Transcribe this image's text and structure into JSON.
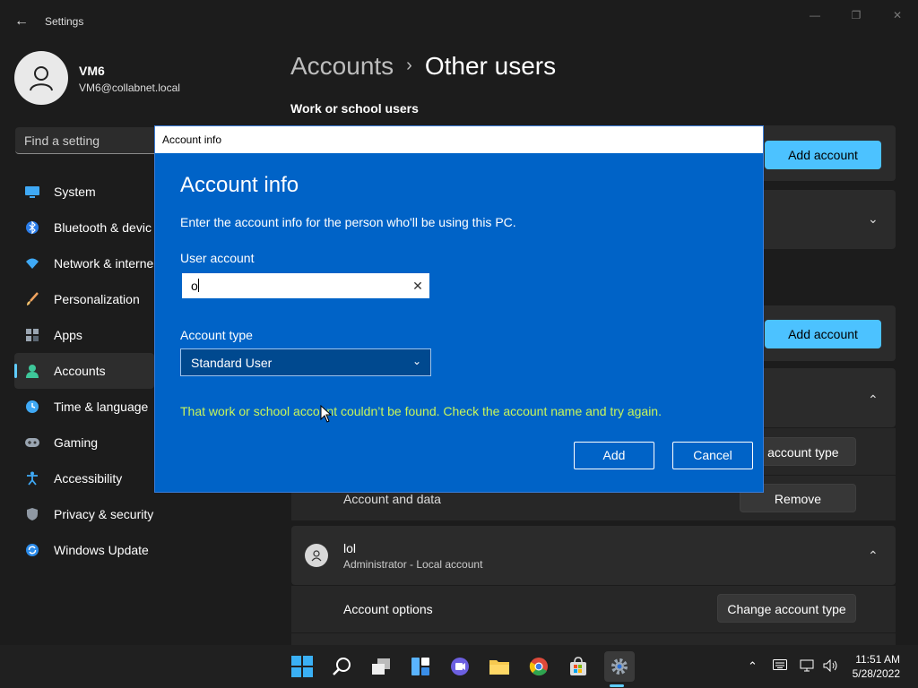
{
  "window": {
    "title": "Settings",
    "back_icon": "←",
    "minimize_icon": "—",
    "maximize_icon": "❐",
    "close_icon": "✕"
  },
  "profile": {
    "name": "VM6",
    "email": "VM6@collabnet.local"
  },
  "search": {
    "placeholder": "Find a setting"
  },
  "sidebar": {
    "items": [
      {
        "label": "System",
        "icon": "system-icon"
      },
      {
        "label": "Bluetooth & devic",
        "icon": "bluetooth-icon"
      },
      {
        "label": "Network & interne",
        "icon": "network-icon"
      },
      {
        "label": "Personalization",
        "icon": "brush-icon"
      },
      {
        "label": "Apps",
        "icon": "apps-icon"
      },
      {
        "label": "Accounts",
        "icon": "accounts-icon",
        "active": true
      },
      {
        "label": "Time & language",
        "icon": "clock-icon"
      },
      {
        "label": "Gaming",
        "icon": "gamepad-icon"
      },
      {
        "label": "Accessibility",
        "icon": "accessibility-icon"
      },
      {
        "label": "Privacy & security",
        "icon": "shield-icon"
      },
      {
        "label": "Windows Update",
        "icon": "update-icon"
      }
    ]
  },
  "main": {
    "breadcrumb_parent": "Accounts",
    "breadcrumb_sep": "›",
    "breadcrumb_current": "Other users",
    "section_work": "Work or school users",
    "add_account_label": "Add account",
    "change_account_type_partial": "e account type",
    "account_and_data": "Account and data",
    "remove_label": "Remove",
    "user_lol": {
      "name": "lol",
      "subtitle": "Administrator - Local account"
    },
    "account_options": "Account options",
    "change_account_type": "Change account type"
  },
  "dialog": {
    "title": "Account info",
    "heading": "Account info",
    "description": "Enter the account info for the person who'll be using this PC.",
    "user_account_label": "User account",
    "user_account_value": "o",
    "account_type_label": "Account type",
    "account_type_value": "Standard User",
    "error": "That work or school account couldn’t be found. Check the account name and try again.",
    "add_label": "Add",
    "cancel_label": "Cancel"
  },
  "taskbar": {
    "time": "11:51 AM",
    "date": "5/28/2022",
    "active_app": "settings"
  },
  "colors": {
    "accent": "#4cc2ff",
    "dialog_bg": "#0063c7",
    "error_text": "#c7f55b"
  }
}
